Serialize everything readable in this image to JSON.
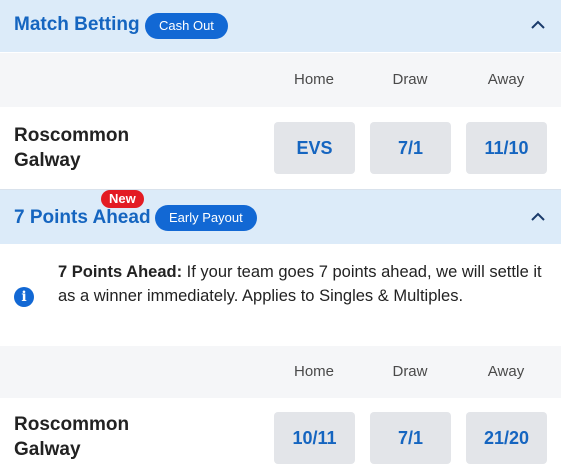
{
  "markets": [
    {
      "title": "Match Betting",
      "pill": "Cash Out",
      "columns": [
        "Home",
        "Draw",
        "Away"
      ],
      "home_team": "Roscommon",
      "away_team": "Galway",
      "odds": [
        "EVS",
        "7/1",
        "11/10"
      ]
    },
    {
      "title": "7 Points Ahead",
      "badge": "New",
      "pill": "Early Payout",
      "info_title": "7 Points Ahead:",
      "info_body": " If your team goes 7 points ahead, we will settle it as a winner immediately. Applies to Singles & Multiples.",
      "columns": [
        "Home",
        "Draw",
        "Away"
      ],
      "home_team": "Roscommon",
      "away_team": "Galway",
      "odds": [
        "10/11",
        "7/1",
        "21/20"
      ]
    }
  ],
  "icons": {
    "collapse": "chevron-up-icon",
    "info": "info-icon"
  },
  "colors": {
    "accent": "#1268d4",
    "header_bg": "#dcebf9",
    "odds_bg": "#e3e5e9",
    "badge_red": "#e31b23"
  }
}
